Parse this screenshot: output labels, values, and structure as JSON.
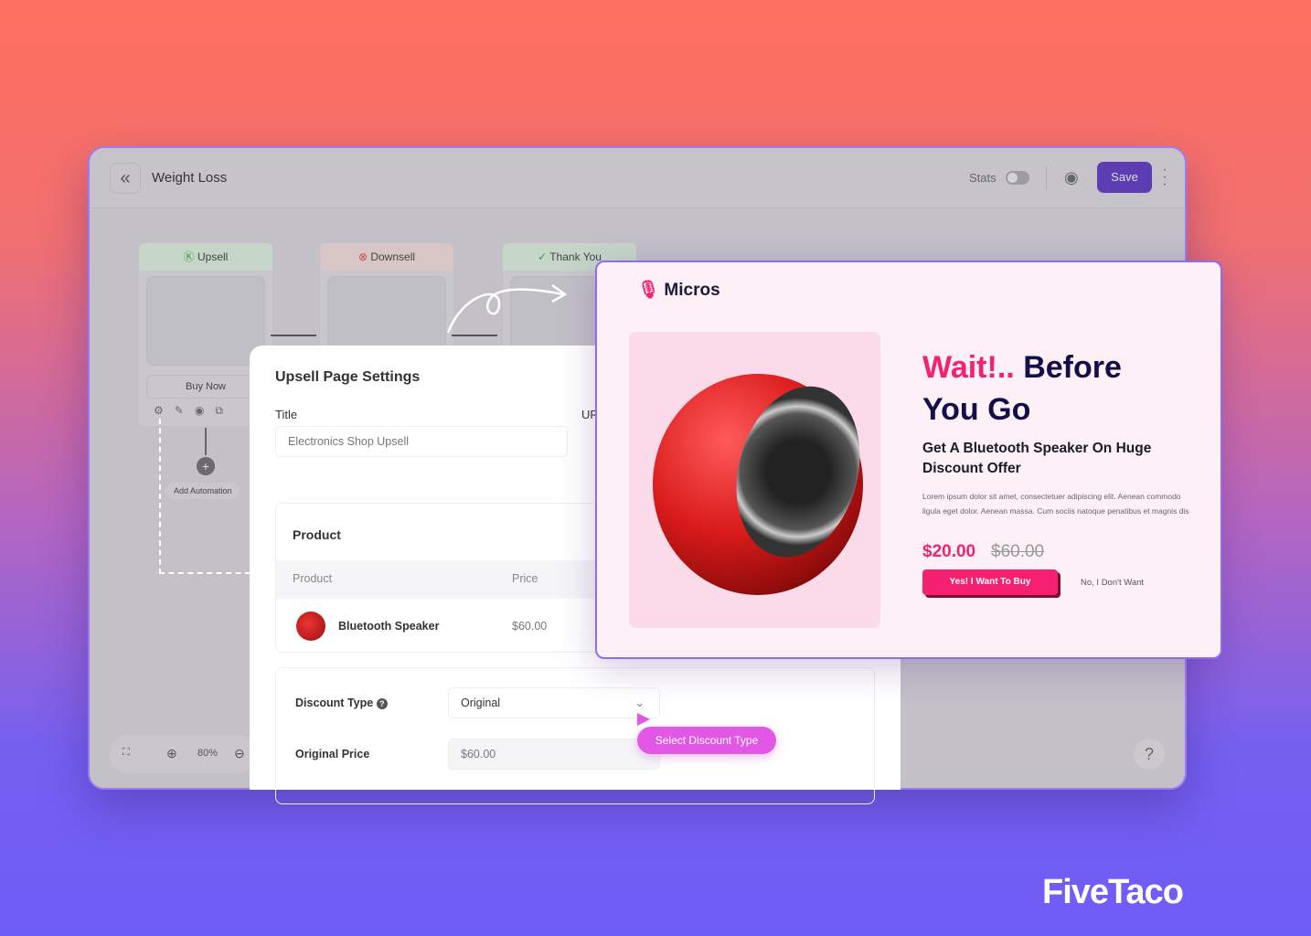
{
  "app": {
    "title": "Weight Loss",
    "stats_label": "Stats",
    "stats_enabled": false,
    "save_label": "Save",
    "zoom_level": "80%",
    "help": "?"
  },
  "flow": {
    "nodes": [
      {
        "label": "Upsell",
        "icon": "upsell-icon",
        "color": "#c6d6c8"
      },
      {
        "label": "Downsell",
        "icon": "downsell-icon",
        "color": "#d8c6c6"
      },
      {
        "label": "Thank You",
        "icon": "check-icon",
        "color": "#c6d6c8"
      }
    ],
    "buy_now": "Buy Now",
    "add_automation": "Add Automation"
  },
  "settings": {
    "title": "Upsell Page Settings",
    "title_label": "Title",
    "title_value": "Electronics Shop Upsell",
    "url_label": "UR",
    "product_section": "Product",
    "columns": [
      "Product",
      "Price"
    ],
    "product": {
      "name": "Bluetooth Speaker",
      "price": "$60.00"
    },
    "discount_type_label": "Discount Type",
    "discount_type_value": "Original",
    "original_price_label": "Original Price",
    "original_price_value": "$60.00",
    "tooltip": "Select Discount Type"
  },
  "preview": {
    "logo": "Micros",
    "headline_accent": "Wait!..",
    "headline_rest": "Before",
    "headline_line2": "You Go",
    "subheading": "Get A Bluetooth Speaker On Huge Discount Offer",
    "body": "Lorem ipsum dolor sit amet, consectetuer adipiscing elit. Aenean commodo ligula eget dolor. Aenean massa. Cum sociis natoque penatibus et magnis dis",
    "price": "$20.00",
    "old_price": "$60.00",
    "yes_button": "Yes! I Want To Buy",
    "no_link": "No, I Don't Want",
    "accent": "#f52170",
    "headline_color": "#140f4a"
  },
  "watermark": "FiveTaco"
}
